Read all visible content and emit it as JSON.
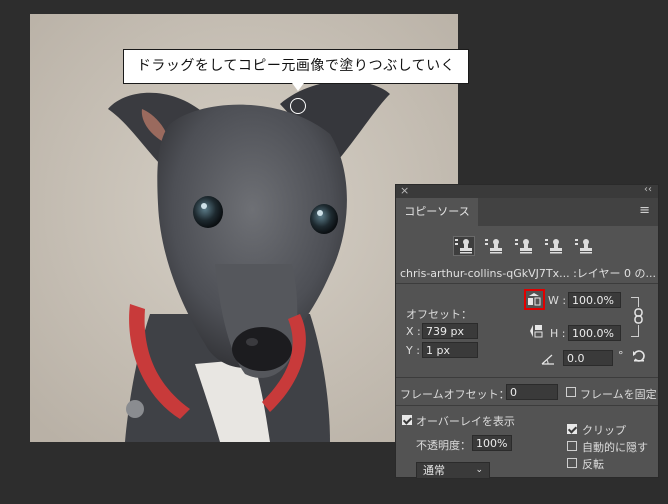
{
  "callout": {
    "text": "ドラッグをしてコピー元画像で塗りつぶしていく"
  },
  "panel": {
    "close_glyph": "×",
    "collapse_glyph": "‹‹",
    "tab_label": "コピーソース",
    "menu_glyph": "≡",
    "source_icons": [
      "clone-source-1-icon",
      "clone-source-2-icon",
      "clone-source-3-icon",
      "clone-source-4-icon",
      "clone-source-5-icon"
    ],
    "source_name": "chris-arthur-collins-qGkVJ7Tx... :レイヤー 0 の...",
    "offset_label": "オフセット：",
    "x_label": "X :",
    "x_value": "739 px",
    "y_label": "Y :",
    "y_value": "1 px",
    "w_label": "W :",
    "w_value": "100.0%",
    "h_label": "H :",
    "h_value": "100.0%",
    "angle_value": "0.0",
    "angle_unit": "°",
    "frame_offset_label": "フレームオフセット：",
    "frame_offset_value": "0",
    "lock_frame_label": "フレームを固定",
    "show_overlay_label": "オーバーレイを表示",
    "opacity_label": "不透明度：",
    "opacity_value": "100%",
    "clip_label": "クリップ",
    "auto_hide_label": "自動的に隠す",
    "invert_label": "反転",
    "blend_mode": "通常",
    "accent_color": "#e00000"
  }
}
